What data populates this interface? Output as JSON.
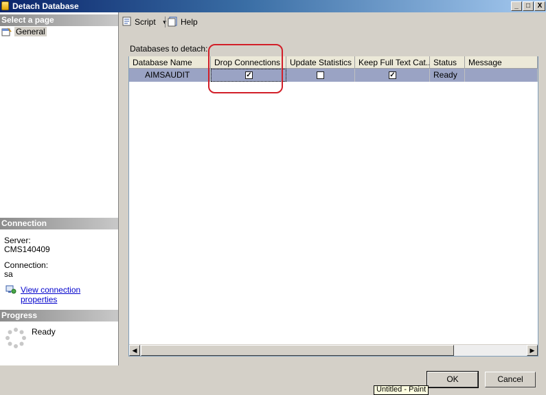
{
  "window": {
    "title": "Detach Database",
    "controls": [
      "_",
      "□",
      "X"
    ]
  },
  "left_pane": {
    "select_page_header": "Select a page",
    "pages": [
      {
        "label": "General",
        "icon": "page-settings-icon"
      }
    ],
    "connection_header": "Connection",
    "server_label": "Server:",
    "server_value": "CMS140409",
    "connection_label": "Connection:",
    "connection_value": "sa",
    "view_properties_link": "View connection properties",
    "progress_header": "Progress",
    "progress_status": "Ready"
  },
  "toolbar": {
    "script_label": "Script",
    "help_label": "Help"
  },
  "main": {
    "grid_label": "Databases to detach:",
    "columns": [
      "Database Name",
      "Drop Connections",
      "Update Statistics",
      "Keep Full Text Cat...",
      "Status",
      "Message"
    ],
    "rows": [
      {
        "database_name": "AIMSAUDIT",
        "drop_connections": true,
        "update_statistics": false,
        "keep_full_text": true,
        "status": "Ready",
        "message": ""
      }
    ]
  },
  "buttons": {
    "ok": "OK",
    "cancel": "Cancel"
  },
  "taskbar_tooltip": "Untitled - Paint",
  "colors": {
    "title_gradient_start": "#0a246a",
    "title_gradient_end": "#a6caf0",
    "selected_row": "#9aa3c4",
    "highlight_annotation": "#d21e28",
    "link": "#0000cc"
  }
}
